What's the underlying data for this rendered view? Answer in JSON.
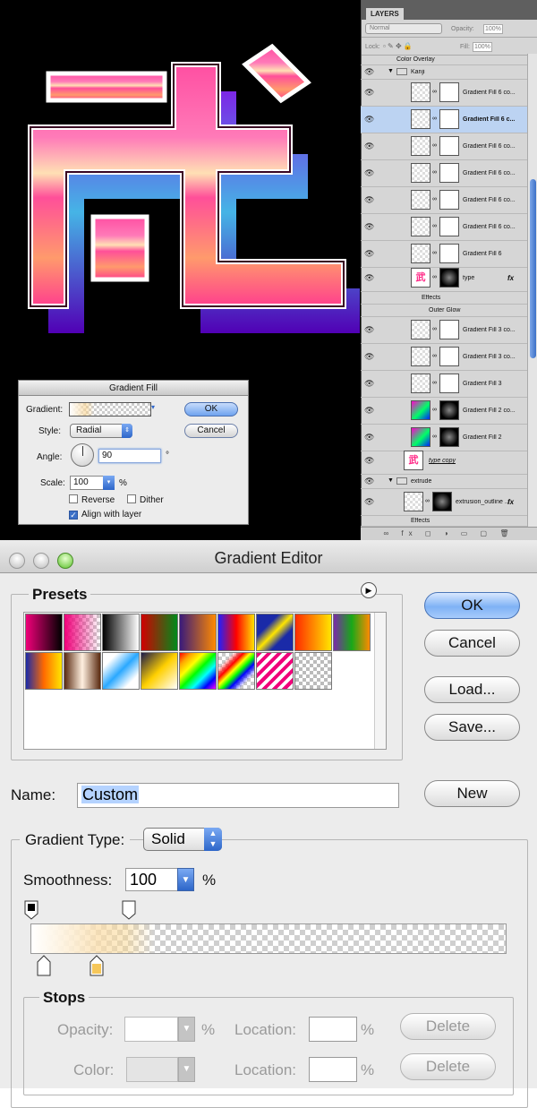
{
  "canvas": {
    "glyph": "武"
  },
  "gradient_fill": {
    "title": "Gradient Fill",
    "gradient_label": "Gradient:",
    "style_label": "Style:",
    "style_value": "Radial",
    "angle_label": "Angle:",
    "angle_value": "90",
    "degree": "°",
    "scale_label": "Scale:",
    "scale_value": "100",
    "percent": "%",
    "reverse_label": "Reverse",
    "dither_label": "Dither",
    "align_label": "Align with layer",
    "ok": "OK",
    "cancel": "Cancel"
  },
  "layers": {
    "tab": "LAYERS",
    "blend_mode": "Normal",
    "opacity_label": "Opacity:",
    "opacity_value": "100%",
    "lock_label": "Lock:",
    "fill_label": "Fill:",
    "fill_value": "100%",
    "rows": [
      {
        "name": "Color Overlay"
      },
      {
        "name": "Kanji"
      },
      {
        "name": "Gradient Fill 6 co..."
      },
      {
        "name": "Gradient Fill 6 c..."
      },
      {
        "name": "Gradient Fill 6 co..."
      },
      {
        "name": "Gradient Fill 6 co..."
      },
      {
        "name": "Gradient Fill 6 co..."
      },
      {
        "name": "Gradient Fill 6 co..."
      },
      {
        "name": "Gradient Fill 6"
      },
      {
        "name": "type"
      },
      {
        "name": "Effects"
      },
      {
        "name": "Outer Glow"
      },
      {
        "name": "Gradient Fill 3 co..."
      },
      {
        "name": "Gradient Fill 3 co..."
      },
      {
        "name": "Gradient Fill 3"
      },
      {
        "name": "Gradient Fill 2 co..."
      },
      {
        "name": "Gradient Fill 2"
      },
      {
        "name": "type copy"
      },
      {
        "name": "extrude"
      },
      {
        "name": "extrusion_outline ..."
      },
      {
        "name": "Effects"
      }
    ],
    "fx": "fx",
    "footer_icons": "∞ fx ◻ ◑ ▭ ▢ 🗑"
  },
  "editor": {
    "title": "Gradient Editor",
    "presets_label": "Presets",
    "ok": "OK",
    "cancel": "Cancel",
    "load": "Load...",
    "save": "Save...",
    "name_label": "Name:",
    "name_value": "Custom",
    "new": "New",
    "type_label": "Gradient Type:",
    "type_value": "Solid",
    "smoothness_label": "Smoothness:",
    "smoothness_value": "100",
    "percent": "%",
    "stops_label": "Stops",
    "opacity_label": "Opacity:",
    "color_label": "Color:",
    "location_label": "Location:",
    "delete": "Delete"
  }
}
